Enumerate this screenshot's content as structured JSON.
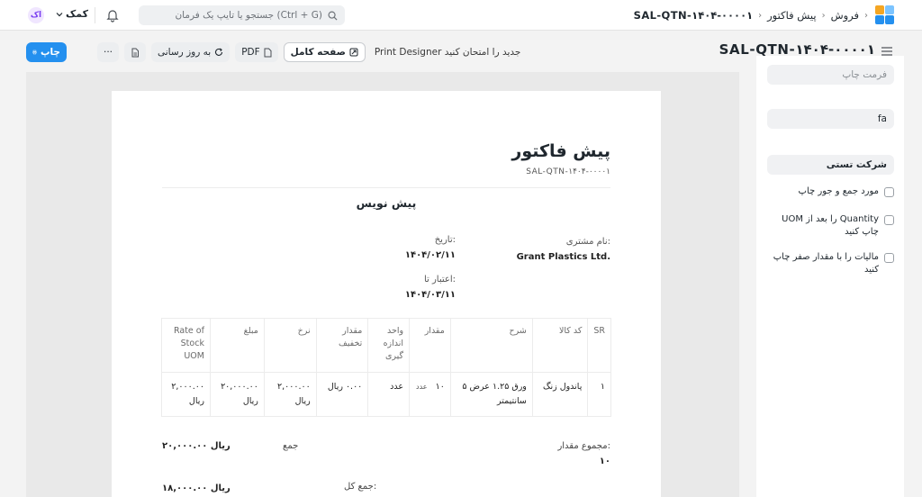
{
  "navbar": {
    "breadcrumbs": [
      "فروش",
      "پیش فاکتور",
      "SAL-QTN-۱۴۰۴-۰۰۰۰۱"
    ],
    "search_placeholder": "جستجو یا تایپ یک فرمان (Ctrl + G)",
    "help_label": "کمک",
    "avatar_initials": "اک"
  },
  "header": {
    "title": "SAL-QTN-۱۴۰۴-۰۰۰۰۱",
    "print_button": "چاپ",
    "more_label": "···",
    "refresh_button": "به روز رسانی",
    "pdf_button": "PDF",
    "fullpage_button": "صفحه کامل",
    "print_designer_text": "Print Designer جدید را امتحان کنید"
  },
  "preview": {
    "doc_title": "پیش فاکتور",
    "doc_code": "SAL-QTN-۱۴۰۴-۰۰۰۰۱",
    "status": "پیش نویس",
    "customer_label": "نام مشتری:",
    "customer_value": "Grant Plastics Ltd.",
    "date_label": "تاریخ:",
    "date_value": "۱۴۰۴/۰۲/۱۱",
    "valid_till_label": "اعتبار تا:",
    "valid_till_value": "۱۴۰۴/۰۳/۱۱",
    "table": {
      "headers": [
        "SR",
        "کد کالا",
        "شرح",
        "مقدار",
        "واحد اندازه گیری",
        "مقدار تخفیف",
        "نرخ",
        "مبلغ",
        "Rate of Stock UOM"
      ],
      "rows": [
        {
          "sr": "۱",
          "item_code": "پاندول زنگ",
          "description": "ورق ۱.۲۵ عرض ۵ سانتیمتر",
          "qty": "۱۰",
          "qty_unit": "عدد",
          "uom": "عدد",
          "discount": "۰.۰۰ ریال",
          "rate": "۲,۰۰۰.۰۰ ریال",
          "amount": "۲۰,۰۰۰.۰۰ ریال",
          "stock_rate": "۲,۰۰۰.۰۰ ریال"
        }
      ]
    },
    "totals": {
      "total_qty_label": "مجموع مقدار:",
      "total_qty_value": "۱۰",
      "total_label": "جمع",
      "total_value": "۲۰,۰۰۰.۰۰ ریال",
      "grand_total_label": "جمع کل:",
      "grand_total_value": "۱۸,۰۰۰.۰۰ ریال"
    }
  },
  "sidebar": {
    "print_format_placeholder": "فرمت چاپ",
    "language_value": "fa",
    "letterhead_value": "شرکت تستی",
    "checks": [
      "مورد جمع و جور چاپ",
      "UOM را بعد از Quantity چاپ کنید",
      "مالیات را با مقدار صفر چاپ کنید"
    ]
  },
  "colors": {
    "primary": "#2490ef",
    "logo_orange": "#f5a623",
    "logo_blue": "#2490ef",
    "logo_light": "#7cc4ff"
  }
}
